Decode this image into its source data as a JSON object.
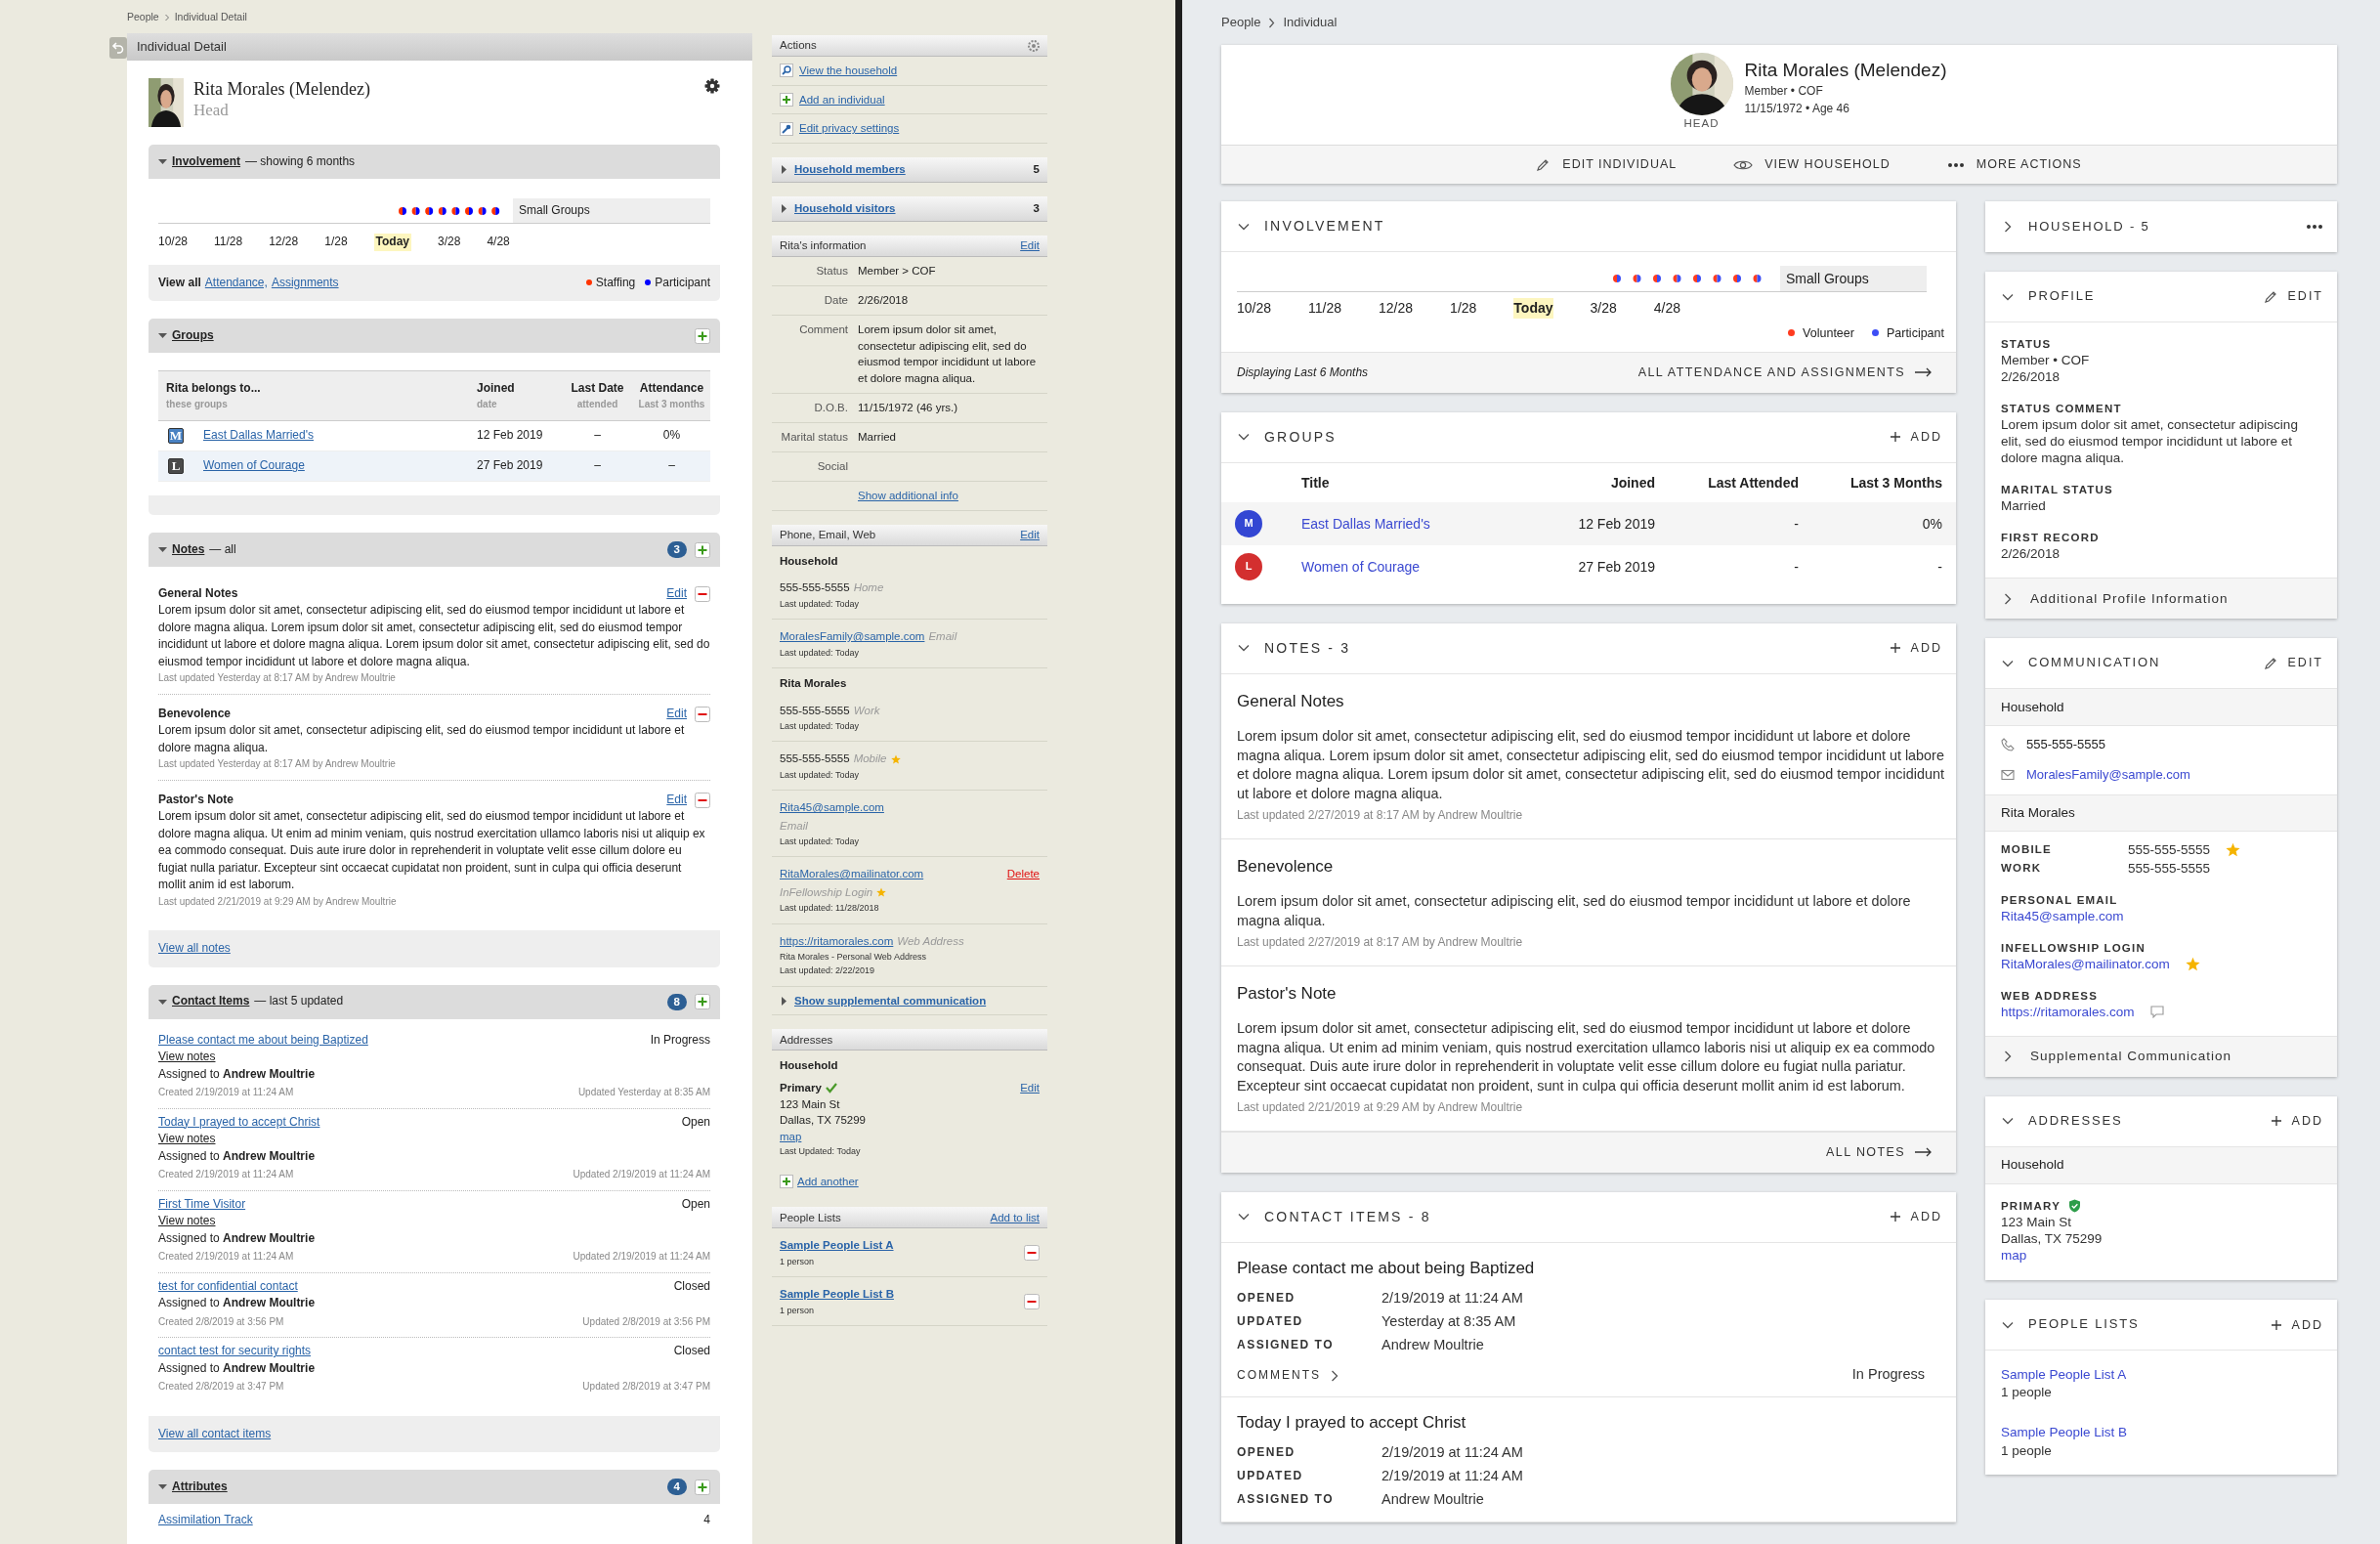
{
  "left": {
    "breadcrumb": [
      "People",
      "Individual Detail"
    ],
    "title": "Individual Detail",
    "person": {
      "name": "Rita Morales (Melendez)",
      "role": "Head"
    },
    "involvement": {
      "expanded": true,
      "title": "Involvement",
      "subtitle": "— showing 6 months",
      "group": "Small Groups",
      "ticks": [
        {
          "label": "10/28",
          "current": false
        },
        {
          "label": "11/28",
          "current": false
        },
        {
          "label": "12/28",
          "current": false
        },
        {
          "label": "1/28",
          "current": false
        },
        {
          "label": "Today",
          "current": true
        },
        {
          "label": "3/28",
          "current": false
        },
        {
          "label": "4/28",
          "current": false
        }
      ],
      "view_all": "View all",
      "links": [
        "Attendance,",
        "Assignments"
      ],
      "legend": [
        {
          "label": "Staffing",
          "color": "#ff3300"
        },
        {
          "label": "Participant",
          "color": "#0000ff"
        }
      ]
    },
    "groups": {
      "expanded": true,
      "title": "Groups",
      "columns": [
        {
          "title": "Rita belongs to...",
          "sub": "these groups"
        },
        {
          "title": "Joined",
          "sub": "date"
        },
        {
          "title": "Last Date",
          "sub": "attended"
        },
        {
          "title": "Attendance",
          "sub": "Last 3 months"
        }
      ],
      "rows": [
        {
          "letter": "M",
          "color": "#4a82c3",
          "name": "East Dallas Married's",
          "joined": "12 Feb 2019",
          "last": "–",
          "attendance": "0%"
        },
        {
          "letter": "L",
          "color": "#4a4a4a",
          "name": "Women of Courage",
          "joined": "27 Feb 2019",
          "last": "–",
          "attendance": "–"
        }
      ]
    },
    "notes": {
      "expanded": true,
      "title": "Notes",
      "subtitle": "— all",
      "count": "3",
      "items": [
        {
          "title": "General Notes",
          "edit": "Edit",
          "body": "Lorem ipsum dolor sit amet, consectetur adipiscing elit, sed do eiusmod tempor incididunt ut labore et dolore magna aliqua. Lorem ipsum dolor sit amet, consectetur adipiscing elit, sed do eiusmod tempor incididunt ut labore et dolore magna aliqua. Lorem ipsum dolor sit amet, consectetur adipiscing elit, sed do eiusmod tempor incididunt ut labore et dolore magna aliqua.",
          "meta": "Last updated Yesterday at 8:17 AM by Andrew Moultrie"
        },
        {
          "title": "Benevolence",
          "edit": "Edit",
          "body": "Lorem ipsum dolor sit amet, consectetur adipiscing elit, sed do eiusmod tempor incididunt ut labore et dolore magna aliqua.",
          "meta": "Last updated Yesterday at 8:17 AM by Andrew Moultrie"
        },
        {
          "title": "Pastor's Note",
          "edit": "Edit",
          "body": "Lorem ipsum dolor sit amet, consectetur adipiscing elit, sed do eiusmod tempor incididunt ut labore et dolore magna aliqua. Ut enim ad minim veniam, quis nostrud exercitation ullamco laboris nisi ut aliquip ex ea commodo consequat. Duis aute irure dolor in reprehenderit in voluptate velit esse cillum dolore eu fugiat nulla pariatur. Excepteur sint occaecat cupidatat non proident, sunt in culpa qui officia deserunt mollit anim id est laborum.",
          "meta": "Last updated 2/21/2019 at 9:29 AM by Andrew Moultrie"
        }
      ],
      "footer": "View all notes"
    },
    "contact_items": {
      "expanded": true,
      "title": "Contact Items",
      "subtitle": "— last 5 updated",
      "count": "8",
      "items": [
        {
          "title": "Please contact me about being Baptized",
          "status": "In Progress",
          "view_notes": "View notes",
          "assigned": "Assigned to **Andrew Moultrie**",
          "created": "Created 2/19/2019 at 11:24 AM",
          "updated": "Updated Yesterday at 8:35 AM"
        },
        {
          "title": "Today I prayed to accept Christ",
          "status": "Open",
          "view_notes": "View notes",
          "assigned": "Assigned to **Andrew Moultrie**",
          "created": "Created 2/19/2019 at 11:24 AM",
          "updated": "Updated 2/19/2019 at 11:24 AM"
        },
        {
          "title": "First Time Visitor",
          "status": "Open",
          "view_notes": "View notes",
          "assigned": "Assigned to **Andrew Moultrie**",
          "created": "Created 2/19/2019 at 11:24 AM",
          "updated": "Updated 2/19/2019 at 11:24 AM"
        },
        {
          "title": "test for confidential contact",
          "status": "Closed",
          "assigned": "Assigned to **Andrew Moultrie**",
          "created": "Created 2/8/2019 at 3:56 PM",
          "updated": "Updated 2/8/2019 at 3:56 PM"
        },
        {
          "title": "contact test for security rights",
          "status": "Closed",
          "assigned": "Assigned to **Andrew Moultrie**",
          "created": "Created 2/8/2019 at 3:47 PM",
          "updated": "Updated 2/8/2019 at 3:47 PM"
        }
      ],
      "footer": "View all contact items"
    },
    "attributes": {
      "expanded": true,
      "title": "Attributes",
      "count": "4",
      "items": [
        {
          "name": "Assimilation Track",
          "value": "4"
        }
      ]
    }
  },
  "side": {
    "actions": {
      "title": "Actions",
      "items": [
        {
          "label": "View the household"
        },
        {
          "label": "Add an individual"
        },
        {
          "label": "Edit privacy settings"
        }
      ]
    },
    "collapsibles": [
      {
        "label": "Household members",
        "count": "5",
        "expanded": false
      },
      {
        "label": "Household visitors",
        "count": "3",
        "expanded": false
      }
    ],
    "info": {
      "title": "Rita's information",
      "edit": "Edit",
      "rows": [
        {
          "label": "Status",
          "value": "Member > COF"
        },
        {
          "label": "Date",
          "value": "2/26/2018"
        },
        {
          "label": "Comment",
          "value": "Lorem ipsum dolor sit amet, consectetur adipiscing elit, sed do eiusmod tempor incididunt ut labore et dolore magna aliqua."
        },
        {
          "label": "D.O.B.",
          "value": "11/15/1972 (46 yrs.)"
        },
        {
          "label": "Marital status",
          "value": "Married"
        },
        {
          "label": "Social"
        }
      ],
      "more": "Show additional info"
    },
    "comm": {
      "title": "Phone, Email, Web",
      "edit": "Edit",
      "groups": [
        {
          "name": "Household",
          "entries": [
            {
              "kind": "phone",
              "value": "555-555-5555",
              "type": "Home",
              "starred": false,
              "updated": "Last updated: Today"
            },
            {
              "kind": "link",
              "value": "MoralesFamily@sample.com",
              "type": "Email",
              "starred": false,
              "updated": "Last updated: Today"
            }
          ]
        },
        {
          "name": "Rita Morales",
          "entries": [
            {
              "kind": "phone",
              "value": "555-555-5555",
              "type": "Work",
              "starred": false,
              "updated": "Last updated: Today"
            },
            {
              "kind": "phone",
              "value": "555-555-5555",
              "type": "Mobile",
              "starred": true,
              "updated": "Last updated: Today"
            },
            {
              "kind": "link_stacked",
              "value": "Rita45@sample.com",
              "type": "Email",
              "starred": false,
              "updated": "Last updated: Today"
            },
            {
              "kind": "link_stacked",
              "value": "RitaMorales@mailinator.com",
              "delete": "Delete",
              "type": "InFellowship Login",
              "starred": true,
              "updated": "Last updated: 11/28/2018"
            },
            {
              "kind": "link",
              "value": "https://ritamorales.com",
              "type": "Web Address",
              "starred": false,
              "note": "Rita Morales - Personal Web Address",
              "updated": "Last updated: 2/22/2019"
            }
          ]
        }
      ],
      "more": "Show supplemental communication",
      "more_expanded": false
    },
    "addresses": {
      "title": "Addresses",
      "groups": [
        {
          "name": "Household",
          "label": "Primary",
          "primary": true,
          "edit": "Edit",
          "lines": [
            "123 Main St",
            "Dallas, TX 75299"
          ],
          "map": "map",
          "updated": "Last Updated: Today"
        }
      ],
      "add": "Add another"
    },
    "people_lists": {
      "title": "People Lists",
      "add": "Add to list",
      "items": [
        {
          "name": "Sample People List A",
          "count": "1 person"
        },
        {
          "name": "Sample People List B",
          "count": "1 person"
        }
      ]
    }
  },
  "right": {
    "breadcrumb": [
      "People",
      "Individual"
    ],
    "header": {
      "name": "Rita Morales (Melendez)",
      "lines": [
        "Member • COF",
        "11/15/1972 • Age 46"
      ],
      "role": "HEAD",
      "actions": [
        {
          "label": "EDIT INDIVIDUAL"
        },
        {
          "label": "VIEW HOUSEHOLD"
        },
        {
          "label": "MORE ACTIONS"
        }
      ]
    },
    "involvement": {
      "title": "INVOLVEMENT",
      "expanded": true,
      "group": "Small Groups",
      "ticks": [
        {
          "label": "10/28",
          "current": false
        },
        {
          "label": "11/28",
          "current": false
        },
        {
          "label": "12/28",
          "current": false
        },
        {
          "label": "1/28",
          "current": false
        },
        {
          "label": "Today",
          "current": true
        },
        {
          "label": "3/28",
          "current": false
        },
        {
          "label": "4/28",
          "current": false
        }
      ],
      "legend": [
        {
          "label": "Volunteer",
          "color": "#ff3b1f"
        },
        {
          "label": "Participant",
          "color": "#3d4ef5"
        }
      ],
      "footer_note": "Displaying Last 6 Months",
      "footer_link": "ALL ATTENDANCE AND ASSIGNMENTS"
    },
    "groups": {
      "title": "GROUPS",
      "expanded": true,
      "add": "ADD",
      "columns": [
        "Title",
        "Joined",
        "Last Attended",
        "Last 3 Months"
      ],
      "rows": [
        {
          "letter": "M",
          "color": "#3346d3",
          "name": "East Dallas Married's",
          "joined": "12 Feb 2019",
          "last": "-",
          "months": "0%"
        },
        {
          "letter": "L",
          "color": "#d32f2f",
          "name": "Women of Courage",
          "joined": "27 Feb 2019",
          "last": "-",
          "months": "-"
        }
      ]
    },
    "notes": {
      "title": "NOTES - 3",
      "expanded": true,
      "add": "ADD",
      "items": [
        {
          "title": "General Notes",
          "body": "Lorem ipsum dolor sit amet, consectetur adipiscing elit, sed do eiusmod tempor incididunt ut labore et dolore magna aliqua. Lorem ipsum dolor sit amet, consectetur adipiscing elit, sed do eiusmod tempor incididunt ut labore et dolore magna aliqua. Lorem ipsum dolor sit amet, consectetur adipiscing elit, sed do eiusmod tempor incididunt ut labore et dolore magna aliqua.",
          "meta": "Last updated 2/27/2019 at 8:17 AM by Andrew Moultrie"
        },
        {
          "title": "Benevolence",
          "body": "Lorem ipsum dolor sit amet, consectetur adipiscing elit, sed do eiusmod tempor incididunt ut labore et dolore magna aliqua.",
          "meta": "Last updated 2/27/2019 at 8:17 AM by Andrew Moultrie"
        },
        {
          "title": "Pastor's Note",
          "body": "Lorem ipsum dolor sit amet, consectetur adipiscing elit, sed do eiusmod tempor incididunt ut labore et dolore magna aliqua. Ut enim ad minim veniam, quis nostrud exercitation ullamco laboris nisi ut aliquip ex ea commodo consequat. Duis aute irure dolor in reprehenderit in voluptate velit esse cillum dolore eu fugiat nulla pariatur. Excepteur sint occaecat cupidatat non proident, sunt in culpa qui officia deserunt mollit anim id est laborum.",
          "meta": "Last updated 2/21/2019 at 9:29 AM by Andrew Moultrie"
        }
      ],
      "footer": "ALL NOTES"
    },
    "contact_items": {
      "title": "CONTACT ITEMS - 8",
      "expanded": true,
      "add": "ADD",
      "items": [
        {
          "title": "Please contact me about being Baptized",
          "fields": [
            {
              "label": "OPENED",
              "value": "2/19/2019 at 11:24 AM"
            },
            {
              "label": "UPDATED",
              "value": "Yesterday at 8:35 AM"
            },
            {
              "label": "ASSIGNED TO",
              "value": "Andrew Moultrie"
            }
          ],
          "comments": "COMMENTS",
          "status": "In Progress"
        },
        {
          "title": "Today I prayed to accept Christ",
          "fields": [
            {
              "label": "OPENED",
              "value": "2/19/2019 at 11:24 AM"
            },
            {
              "label": "UPDATED",
              "value": "2/19/2019 at 11:24 AM"
            },
            {
              "label": "ASSIGNED TO",
              "value": "Andrew Moultrie"
            }
          ]
        }
      ]
    },
    "sidebar": {
      "household": {
        "title": "HOUSEHOLD - 5",
        "expanded": false
      },
      "profile": {
        "title": "PROFILE",
        "expanded": true,
        "edit": "EDIT",
        "fields": [
          {
            "label": "STATUS",
            "lines": [
              "Member • COF",
              "2/26/2018"
            ]
          },
          {
            "label": "STATUS COMMENT",
            "lines": [
              "Lorem ipsum dolor sit amet, consectetur adipiscing elit, sed do eiusmod tempor incididunt ut labore et dolore magna aliqua."
            ]
          },
          {
            "label": "MARITAL STATUS",
            "lines": [
              "Married"
            ]
          },
          {
            "label": "FIRST RECORD",
            "lines": [
              "2/26/2018"
            ]
          }
        ],
        "more": "Additional Profile Information",
        "more_expanded": false
      },
      "communication": {
        "title": "COMMUNICATION",
        "expanded": true,
        "edit": "EDIT",
        "household": {
          "name": "Household",
          "phone": "555-555-5555",
          "email": "MoralesFamily@sample.com"
        },
        "person": {
          "name": "Rita Morales",
          "pairs": [
            {
              "label": "MOBILE",
              "value": "555-555-5555",
              "starred": true
            },
            {
              "label": "WORK",
              "value": "555-555-5555",
              "starred": false
            }
          ],
          "fields": [
            {
              "label": "PERSONAL EMAIL",
              "value": "Rita45@sample.com",
              "starred": false,
              "kind": "plain"
            },
            {
              "label": "INFELLOWSHIP LOGIN",
              "value": "RitaMorales@mailinator.com",
              "starred": true,
              "kind": "plain"
            },
            {
              "label": "WEB ADDRESS",
              "value": "https://ritamorales.com",
              "starred": false,
              "kind": "with_comment"
            }
          ]
        },
        "more": "Supplemental Communication",
        "more_expanded": false
      },
      "addresses": {
        "title": "ADDRESSES",
        "expanded": true,
        "add": "ADD",
        "groups": [
          {
            "name": "Household",
            "label": "PRIMARY",
            "verified": true,
            "lines": [
              "123 Main St",
              "Dallas, TX 75299"
            ],
            "map": "map"
          }
        ]
      },
      "people_lists": {
        "title": "PEOPLE LISTS",
        "expanded": true,
        "add": "ADD",
        "items": [
          {
            "name": "Sample People List A",
            "count": "1 people"
          },
          {
            "name": "Sample People List B",
            "count": "1 people"
          }
        ]
      }
    }
  }
}
